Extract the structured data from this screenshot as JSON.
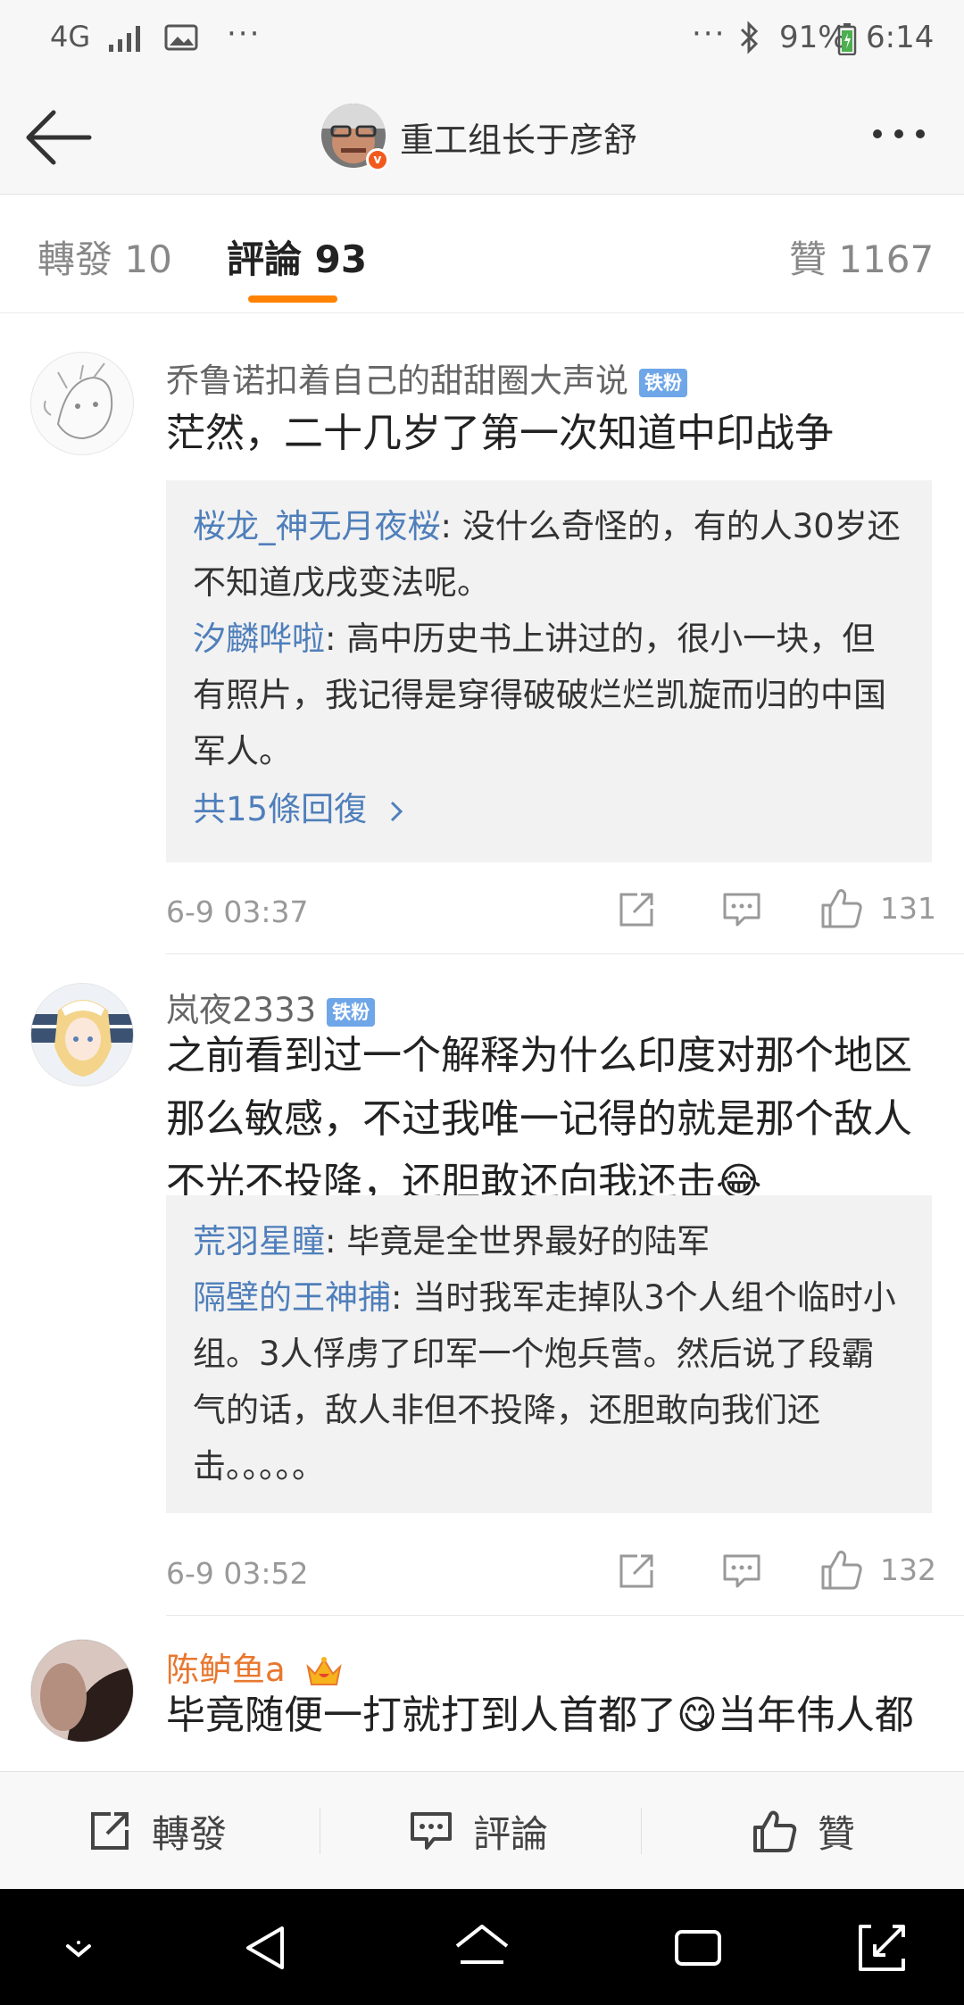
{
  "status_bar": {
    "network": "4G",
    "dots_left": "···",
    "dots_right": "···",
    "battery": "91%",
    "time": "6:14"
  },
  "header": {
    "title": "重工组长于彦舒"
  },
  "tabs": {
    "repost": "轉發 10",
    "comment": "評論 93",
    "like": "贊 1167"
  },
  "comments": [
    {
      "name": "乔鲁诺扣着自己的甜甜圈大声说",
      "badge": "铁粉",
      "text": "茫然，二十几岁了第一次知道中印战争",
      "replies": [
        {
          "name": "桜龙_神无月夜桜",
          "text": ": 没什么奇怪的，有的人30岁还不知道戊戌变法呢。"
        },
        {
          "name": "汐麟哗啦",
          "text": ": 高中历史书上讲过的，很小一块，但有照片，我记得是穿得破破烂烂凯旋而归的中国军人。"
        }
      ],
      "more_replies": "共15條回復",
      "time": "6-9 03:37",
      "likes": "131"
    },
    {
      "name": "岚夜2333",
      "badge": "铁粉",
      "text": "之前看到过一个解释为什么印度对那个地区那么敏感，不过我唯一记得的就是那个敌人不光不投降，还胆敢还向我还击😂",
      "replies": [
        {
          "name": "荒羽星瞳",
          "text": ": 毕竟是全世界最好的陆军"
        },
        {
          "name": "隔壁的王神捕",
          "text": ": 当时我军走掉队3个人组个临时小组。3人俘虏了印军一个炮兵营。然后说了段霸气的话，敌人非但不投降，还胆敢向我们还击。。。。。"
        }
      ],
      "time": "6-9 03:52",
      "likes": "132"
    },
    {
      "name": "陈鲈鱼a",
      "text": "毕竟随便一打就打到人首都了😋当年伟人都"
    }
  ],
  "bottom_bar": {
    "repost": "轉發",
    "comment": "評論",
    "like": "贊"
  },
  "colors": {
    "accent": "#ff8200",
    "link": "#4f7fbb",
    "fan_badge": "#6fa6e8",
    "vip_name": "#e8772f"
  },
  "icons": [
    "back-arrow-icon",
    "more-dots-icon",
    "share-icon",
    "comment-icon",
    "like-icon",
    "chevron-right-icon",
    "crown-icon"
  ]
}
